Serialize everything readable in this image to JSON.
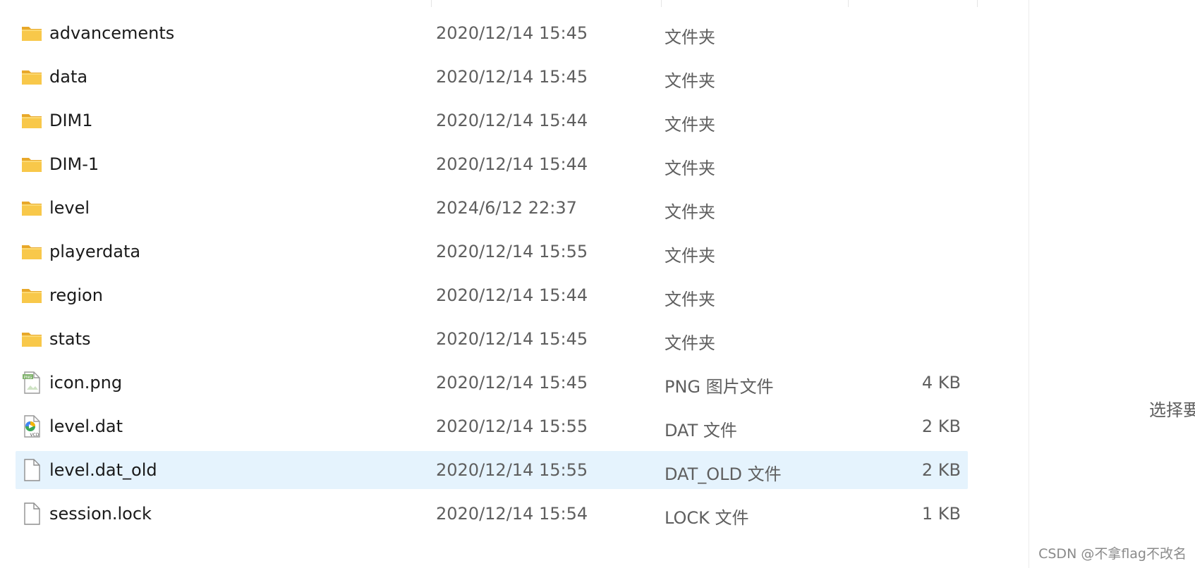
{
  "files": [
    {
      "name": "advancements",
      "date": "2020/12/14 15:45",
      "type": "文件夹",
      "size": "",
      "icon": "folder-icon"
    },
    {
      "name": "data",
      "date": "2020/12/14 15:45",
      "type": "文件夹",
      "size": "",
      "icon": "folder-icon"
    },
    {
      "name": "DIM1",
      "date": "2020/12/14 15:44",
      "type": "文件夹",
      "size": "",
      "icon": "folder-icon"
    },
    {
      "name": "DIM-1",
      "date": "2020/12/14 15:44",
      "type": "文件夹",
      "size": "",
      "icon": "folder-icon"
    },
    {
      "name": "level",
      "date": "2024/6/12 22:37",
      "type": "文件夹",
      "size": "",
      "icon": "folder-icon"
    },
    {
      "name": "playerdata",
      "date": "2020/12/14 15:55",
      "type": "文件夹",
      "size": "",
      "icon": "folder-icon"
    },
    {
      "name": "region",
      "date": "2020/12/14 15:44",
      "type": "文件夹",
      "size": "",
      "icon": "folder-icon"
    },
    {
      "name": "stats",
      "date": "2020/12/14 15:45",
      "type": "文件夹",
      "size": "",
      "icon": "folder-icon"
    },
    {
      "name": "icon.png",
      "date": "2020/12/14 15:45",
      "type": "PNG 图片文件",
      "size": "4 KB",
      "icon": "png-file-icon"
    },
    {
      "name": "level.dat",
      "date": "2020/12/14 15:55",
      "type": "DAT 文件",
      "size": "2 KB",
      "icon": "vcd-file-icon"
    },
    {
      "name": "level.dat_old",
      "date": "2020/12/14 15:55",
      "type": "DAT_OLD 文件",
      "size": "2 KB",
      "icon": "blank-file-icon",
      "selected": true
    },
    {
      "name": "session.lock",
      "date": "2020/12/14 15:54",
      "type": "LOCK 文件",
      "size": "1 KB",
      "icon": "blank-file-icon"
    }
  ],
  "details_pane": {
    "hint": "选择要"
  },
  "watermark": "CSDN @不拿flag不改名",
  "icon_labels": {
    "png": "PNG",
    "vcd": "VCD"
  },
  "colors": {
    "selected_row": "#e5f3fd",
    "folder": "#f8c84a",
    "text_primary": "#1a1a1a",
    "text_secondary": "#5f5f5f"
  }
}
